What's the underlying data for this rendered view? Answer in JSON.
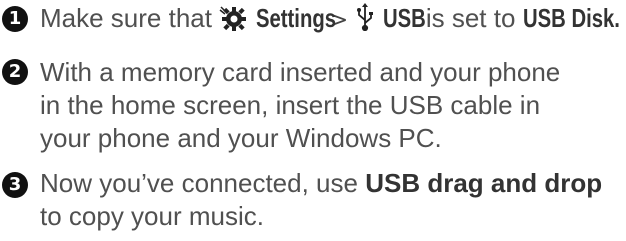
{
  "steps": [
    {
      "number": "1",
      "prefix": "Make sure that",
      "settings_label": "Settings",
      "separator": ">",
      "usb_label": "USB",
      "middle": "is set to",
      "usb_disk_label": "USB Disk."
    },
    {
      "number": "2",
      "text": "With a memory card inserted and your phone in the home screen, insert the USB cable in your phone and your Windows PC."
    },
    {
      "number": "3",
      "prefix": "Now you’ve connected, use",
      "bold": "USB drag and drop",
      "suffix": "to copy your music."
    }
  ],
  "icons": {
    "settings": "gear-icon",
    "usb": "usb-icon"
  },
  "colors": {
    "badge_bg": "#111111",
    "body_text": "#505050"
  }
}
